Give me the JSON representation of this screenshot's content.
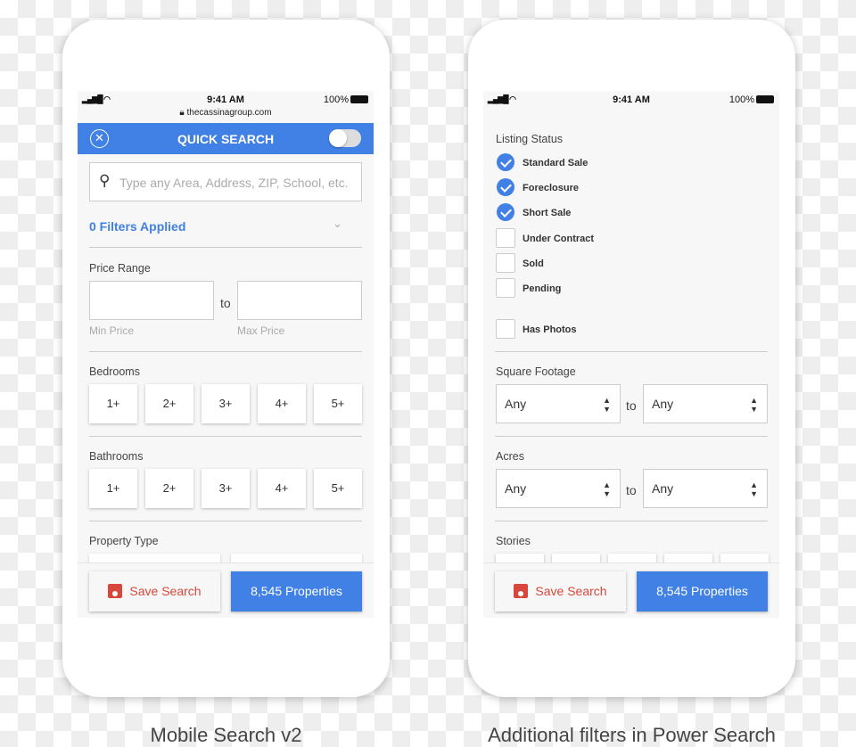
{
  "left": {
    "status": {
      "time": "9:41 AM",
      "battery": "100%"
    },
    "url": "thecassinagroup.com",
    "header": {
      "title": "QUICK SEARCH"
    },
    "search": {
      "placeholder": "Type any Area, Address, ZIP, School, etc."
    },
    "filters_applied": "0 Filters Applied",
    "price": {
      "label": "Price Range",
      "to": "to",
      "min_hint": "Min Price",
      "max_hint": "Max Price"
    },
    "bedrooms": {
      "label": "Bedrooms",
      "options": [
        "1+",
        "2+",
        "3+",
        "4+",
        "5+"
      ]
    },
    "bathrooms": {
      "label": "Bathrooms",
      "options": [
        "1+",
        "2+",
        "3+",
        "4+",
        "5+"
      ]
    },
    "property_type": {
      "label": "Property Type"
    },
    "footer": {
      "save": "Save Search",
      "results": "8,545 Properties"
    }
  },
  "right": {
    "status": {
      "time": "9:41 AM",
      "battery": "100%"
    },
    "listing_status": {
      "label": "Listing Status",
      "items": [
        {
          "label": "Standard Sale",
          "checked": true
        },
        {
          "label": "Foreclosure",
          "checked": true
        },
        {
          "label": "Short Sale",
          "checked": true
        },
        {
          "label": "Under Contract",
          "checked": false
        },
        {
          "label": "Sold",
          "checked": false
        },
        {
          "label": "Pending",
          "checked": false
        }
      ]
    },
    "has_photos": {
      "label": "Has Photos",
      "checked": false
    },
    "square_footage": {
      "label": "Square Footage",
      "min": "Any",
      "max": "Any",
      "to": "to"
    },
    "acres": {
      "label": "Acres",
      "min": "Any",
      "max": "Any",
      "to": "to"
    },
    "stories": {
      "label": "Stories"
    },
    "footer": {
      "save": "Save Search",
      "results": "8,545 Properties"
    }
  },
  "captions": {
    "left": "Mobile Search v2",
    "right": "Additional filters in Power Search"
  },
  "colors": {
    "accent": "#4180e5",
    "save": "#d8473b"
  }
}
